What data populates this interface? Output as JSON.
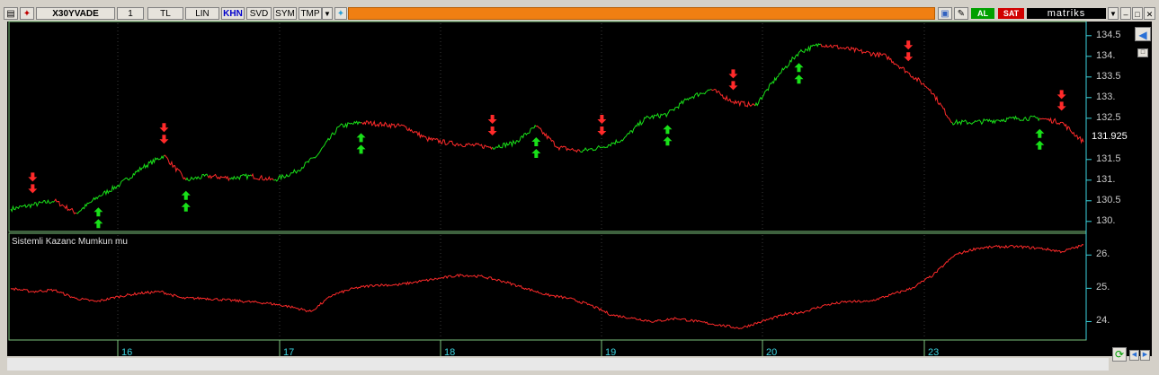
{
  "toolbar": {
    "symbol": "X30YVADE",
    "period": "1",
    "currency": "TL",
    "scale": "LIN",
    "khn": "KHN",
    "svd": "SVD",
    "sym": "SYM",
    "tmp": "TMP",
    "al_label": "AL",
    "sat_label": "SAT",
    "brand": "matriks"
  },
  "main_panel": {
    "price_label": "131.925",
    "yticks": [
      "134.5",
      "134.",
      "133.5",
      "133.",
      "132.5",
      "131.5",
      "131.",
      "130.5",
      "130."
    ]
  },
  "lower_panel": {
    "title": "Sistemli Kazanc Mumkun mu",
    "yticks": [
      "26.",
      "25.",
      "24."
    ]
  },
  "xaxis": {
    "labels": [
      "16",
      "17",
      "18",
      "19",
      "20",
      "23"
    ]
  },
  "chart_data": [
    {
      "type": "line",
      "ylim": [
        129.8,
        134.8
      ],
      "x_categories": [
        "16",
        "17",
        "18",
        "19",
        "20",
        "23"
      ],
      "series": [
        {
          "values": [
            130.3,
            130.4,
            130.5,
            130.2,
            130.6,
            130.9,
            131.3,
            131.6,
            131.0,
            131.1,
            131.05,
            131.1,
            131.0,
            131.2,
            131.6,
            132.3,
            132.4,
            132.35,
            132.3,
            132.0,
            131.9,
            131.85,
            131.8,
            131.9,
            132.3,
            131.8,
            131.7,
            131.8,
            132.0,
            132.5,
            132.6,
            133.0,
            133.2,
            132.9,
            132.8,
            133.5,
            134.1,
            134.3,
            134.2,
            134.1,
            134.0,
            133.6,
            133.2,
            132.4,
            132.4,
            132.45,
            132.5,
            132.5,
            132.4,
            131.925
          ],
          "signal_colors": {
            "up": "#19e019",
            "down": "#ff2a2a"
          }
        }
      ],
      "buy_signals": [
        4,
        8,
        16,
        24,
        30,
        36,
        47
      ],
      "sell_signals": [
        1,
        7,
        22,
        27,
        33,
        41,
        48
      ]
    },
    {
      "type": "line",
      "title": "Sistemli Kazanc Mumkun mu",
      "ylim": [
        23.5,
        26.6
      ],
      "series": [
        {
          "values": [
            25.0,
            24.9,
            24.95,
            24.7,
            24.6,
            24.75,
            24.85,
            24.9,
            24.7,
            24.7,
            24.65,
            24.6,
            24.55,
            24.45,
            24.3,
            24.8,
            25.0,
            25.1,
            25.1,
            25.2,
            25.3,
            25.4,
            25.35,
            25.2,
            25.0,
            24.8,
            24.7,
            24.5,
            24.2,
            24.1,
            24.0,
            24.1,
            24.0,
            23.9,
            23.8,
            24.0,
            24.2,
            24.3,
            24.5,
            24.6,
            24.6,
            24.8,
            25.0,
            25.4,
            26.0,
            26.2,
            26.25,
            26.25,
            26.2,
            26.1,
            26.3
          ],
          "color": "#ff2a2a"
        }
      ]
    }
  ]
}
